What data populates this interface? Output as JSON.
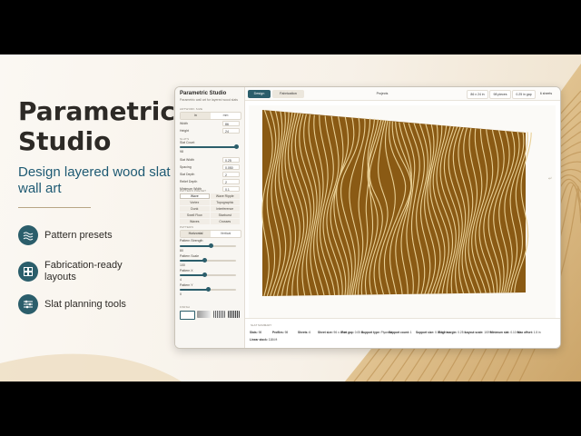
{
  "hero": {
    "title": "Parametric Studio",
    "subtitle": "Design layered wood slat wall art"
  },
  "features": [
    {
      "label": "Pattern presets",
      "icon": "waves-icon"
    },
    {
      "label": "Fabrication-ready layouts",
      "icon": "layout-grid-icon"
    },
    {
      "label": "Slat planning tools",
      "icon": "sliders-icon"
    }
  ],
  "app": {
    "title": "Parametric Studio",
    "subtitle": "Parametric wall art for layered wood slats",
    "tabs": [
      {
        "label": "Design",
        "active": true
      },
      {
        "label": "Fabrication",
        "active": false
      }
    ],
    "projects_label": "Projects",
    "size_label": "86 x 24 in",
    "pieces_label": "98 pieces",
    "gap_label": "0.25 in gap",
    "sheets_label": "6 sheets"
  },
  "sidebar": {
    "artwork_size": {
      "label": "ARTWORK SIZE",
      "units": [
        {
          "label": "in",
          "active": true
        },
        {
          "label": "mm",
          "active": false
        }
      ],
      "width_label": "Width",
      "width_value": "86",
      "height_label": "Height",
      "height_value": "24"
    },
    "slats": {
      "label": "SLATS",
      "slat_count_label": "Slat Count",
      "slat_count_value": "98",
      "slat_count_level": 1.0,
      "rows": [
        {
          "label": "Slat Width",
          "value": "0.25"
        },
        {
          "label": "Spacing",
          "value": "0.050"
        },
        {
          "label": "Slat Depth",
          "value": "2"
        },
        {
          "label": "Relief Depth",
          "value": "2"
        },
        {
          "label": "Minimum Width",
          "value": "0.1"
        }
      ]
    },
    "pattern_preset": {
      "label": "PATTERN PRESET",
      "options": [
        {
          "label": "Wave",
          "active": true
        },
        {
          "label": "Wave Ripple",
          "active": false
        },
        {
          "label": "Vortex",
          "active": false
        },
        {
          "label": "Topographic",
          "active": false
        },
        {
          "label": "Dunk",
          "active": false
        },
        {
          "label": "Interference",
          "active": false
        },
        {
          "label": "Swell Flow",
          "active": false
        },
        {
          "label": "Starburst",
          "active": false
        },
        {
          "label": "Waves",
          "active": false
        },
        {
          "label": "Crosses",
          "active": false
        }
      ]
    },
    "pattern": {
      "label": "PATTERN",
      "orientation": [
        {
          "label": "Horizontal",
          "active": true
        },
        {
          "label": "Vertical",
          "active": false
        }
      ],
      "sliders": [
        {
          "label": "Pattern Strength",
          "value": "80",
          "level": 0.55
        },
        {
          "label": "Pattern Scale",
          "value": "100",
          "level": 0.45
        },
        {
          "label": "Pattern X",
          "value": "4",
          "level": 0.45
        },
        {
          "label": "Pattern Y",
          "value": "0",
          "level": 0.5
        }
      ]
    },
    "finish": {
      "label": "FINISH"
    }
  },
  "summary": {
    "label": "SLAT SUMMARY",
    "items": [
      {
        "key": "Slats:",
        "value": "98"
      },
      {
        "key": "Profiles:",
        "value": "98"
      },
      {
        "key": "Sheets:",
        "value": "6"
      },
      {
        "key": "Sheet size:",
        "value": "96 x 48 in"
      },
      {
        "key": "Part gap:",
        "value": "0.05 in"
      },
      {
        "key": "Support type:",
        "value": "Plywood"
      },
      {
        "key": "Support count:",
        "value": "1"
      },
      {
        "key": "Support size:",
        "value": "0.50 x 2 in"
      },
      {
        "key": "Edge margin:",
        "value": "0.25 in"
      },
      {
        "key": "Layout scale:",
        "value": "100%"
      },
      {
        "key": "Minimum slat:",
        "value": "0.10 in"
      },
      {
        "key": "Max offset:",
        "value": "1.5 in"
      },
      {
        "key": "Linear stock:",
        "value": "1184 ft"
      }
    ]
  },
  "colors": {
    "accent": "#2b5e6b",
    "wood_dark": "#8a5a14",
    "wood_light": "#e8cf95",
    "hero_title": "#2d2a26",
    "hero_subtitle": "#1e5a73"
  }
}
